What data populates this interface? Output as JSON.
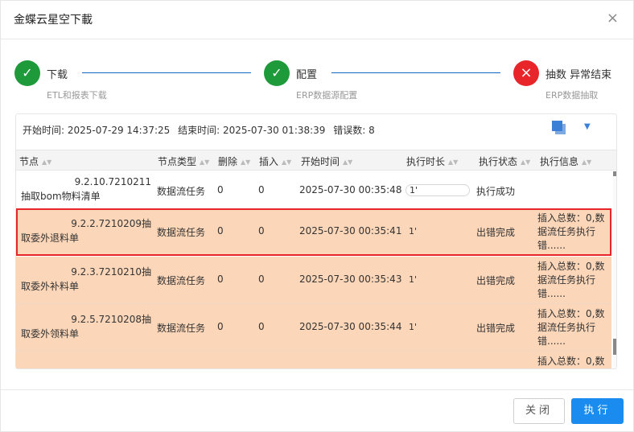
{
  "dialog": {
    "title": "金蝶云星空下載",
    "close_glyph": "×"
  },
  "steps": [
    {
      "title": "下载",
      "subtitle": "ETL和报表下载",
      "status": "success",
      "glyph": "✓"
    },
    {
      "title": "配置",
      "subtitle": "ERP数据源配置",
      "status": "success",
      "glyph": "✓"
    },
    {
      "title": "抽数 异常结束",
      "subtitle": "ERP数据抽取",
      "status": "error",
      "glyph": "×"
    }
  ],
  "summary": {
    "start": "开始时间: 2025-07-29 14:37:25",
    "end": "结束时间: 2025-07-30 01:38:39",
    "errors": "错误数: 8"
  },
  "table": {
    "headers": [
      "节点",
      "节点类型",
      "删除",
      "插入",
      "开始时间",
      "执行时长",
      "执行状态",
      "执行信息"
    ],
    "sort_glyph": "▲▼",
    "rows": [
      {
        "node_l1": "9.2.10.7210211",
        "node_l2": "抽取bom物料清单",
        "type": "数据流任务",
        "delete": "0",
        "insert": "0",
        "start": "2025-07-30 00:35:48",
        "duration": "1'",
        "status": "执行成功",
        "info": ""
      },
      {
        "node_l1": "9.2.2.7210209抽",
        "node_l2": "取委外退料单",
        "type": "数据流任务",
        "delete": "0",
        "insert": "0",
        "start": "2025-07-30 00:35:41",
        "duration": "1'",
        "status": "出错完成",
        "info": "插入总数：0,数据流任务执行错......"
      },
      {
        "node_l1": "9.2.3.7210210抽",
        "node_l2": "取委外补料单",
        "type": "数据流任务",
        "delete": "0",
        "insert": "0",
        "start": "2025-07-30 00:35:43",
        "duration": "1'",
        "status": "出错完成",
        "info": "插入总数：0,数据流任务执行错......"
      },
      {
        "node_l1": "9.2.5.7210208抽",
        "node_l2": "取委外领料单",
        "type": "数据流任务",
        "delete": "0",
        "insert": "0",
        "start": "2025-07-30 00:35:44",
        "duration": "1'",
        "status": "出错完成",
        "info": "插入总数：0,数据流任务执行错......"
      },
      {
        "node_l1": "",
        "node_l2": "",
        "type": "",
        "delete": "",
        "insert": "",
        "start": "",
        "duration": "",
        "status": "",
        "info": "插入总数：0,数"
      }
    ]
  },
  "footer": {
    "close_label": "关闭",
    "run_label": "执行"
  },
  "colors": {
    "success": "#1e9a3b",
    "error": "#e8262a",
    "accent": "#1a8cf0",
    "error_row": "#fcd6b8"
  }
}
